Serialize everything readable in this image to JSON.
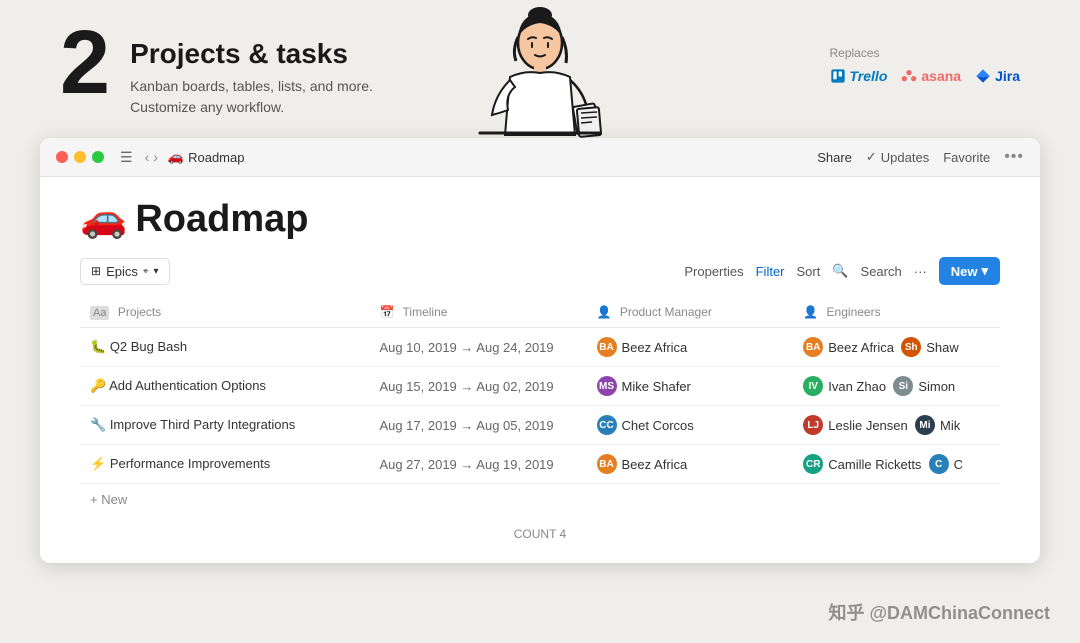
{
  "top": {
    "number": "2",
    "title": "Projects & tasks",
    "subtitle_line1": "Kanban boards, tables, lists, and more.",
    "subtitle_line2": "Customize any workflow.",
    "replaces_label": "Replaces",
    "logos": [
      {
        "name": "Trello",
        "type": "trello"
      },
      {
        "name": "asana",
        "type": "asana"
      },
      {
        "name": "Jira",
        "type": "jira"
      }
    ]
  },
  "titlebar": {
    "page_icon": "🚗",
    "page_name": "Roadmap",
    "share": "Share",
    "updates_check": "✓",
    "updates": "Updates",
    "favorite": "Favorite"
  },
  "page": {
    "heading_icon": "🚗",
    "heading": "Roadmap"
  },
  "toolbar": {
    "epics_icon": "⊞",
    "epics_label": "Epics",
    "properties": "Properties",
    "filter": "Filter",
    "sort": "Sort",
    "search_icon": "🔍",
    "search": "Search",
    "more": "···",
    "new_label": "New",
    "dropdown": "▾"
  },
  "table": {
    "columns": [
      {
        "key": "project",
        "icon": "Aa",
        "label": "Projects"
      },
      {
        "key": "timeline",
        "icon": "📅",
        "label": "Timeline"
      },
      {
        "key": "pm",
        "icon": "👤",
        "label": "Product Manager"
      },
      {
        "key": "engineers",
        "icon": "👤",
        "label": "Engineers"
      }
    ],
    "rows": [
      {
        "icon": "🐛",
        "project": "Q2 Bug Bash",
        "timeline": "Aug 10, 2019 → Aug 24, 2019",
        "pm": "Beez Africa",
        "pm_avatar": "BA",
        "pm_color": "avatar-ba",
        "engineers": "Beez Africa",
        "eng_avatar1": "BA",
        "eng_color1": "avatar-ba",
        "eng_name2": "Shaw",
        "eng_avatar2": "Sh",
        "eng_color2": "avatar-sh"
      },
      {
        "icon": "🔑",
        "project": "Add Authentication Options",
        "timeline": "Aug 15, 2019 → Aug 02, 2019",
        "pm": "Mike Shafer",
        "pm_avatar": "MS",
        "pm_color": "avatar-ms",
        "engineers": "Ivan Zhao",
        "eng_avatar1": "IV",
        "eng_color1": "avatar-iv",
        "eng_name2": "Simon",
        "eng_avatar2": "Si",
        "eng_color2": "avatar-si"
      },
      {
        "icon": "🔧",
        "project": "Improve Third Party Integrations",
        "timeline": "Aug 17, 2019 → Aug 05, 2019",
        "pm": "Chet Corcos",
        "pm_avatar": "CC",
        "pm_color": "avatar-cc",
        "engineers": "Leslie Jensen",
        "eng_avatar1": "LJ",
        "eng_color1": "avatar-lj",
        "eng_name2": "Mik",
        "eng_avatar2": "Mi",
        "eng_color2": "avatar-mi"
      },
      {
        "icon": "⚡",
        "project": "Performance Improvements",
        "timeline": "Aug 27, 2019 → Aug 19, 2019",
        "pm": "Beez Africa",
        "pm_avatar": "BA",
        "pm_color": "avatar-ba",
        "engineers": "Camille Ricketts",
        "eng_avatar1": "CR",
        "eng_color1": "avatar-cr",
        "eng_name2": "C",
        "eng_avatar2": "C",
        "eng_color2": "avatar-cc"
      }
    ],
    "add_new": "+ New",
    "count_label": "COUNT",
    "count_value": "4"
  },
  "watermark": "知乎 @DAMChinaConnect"
}
